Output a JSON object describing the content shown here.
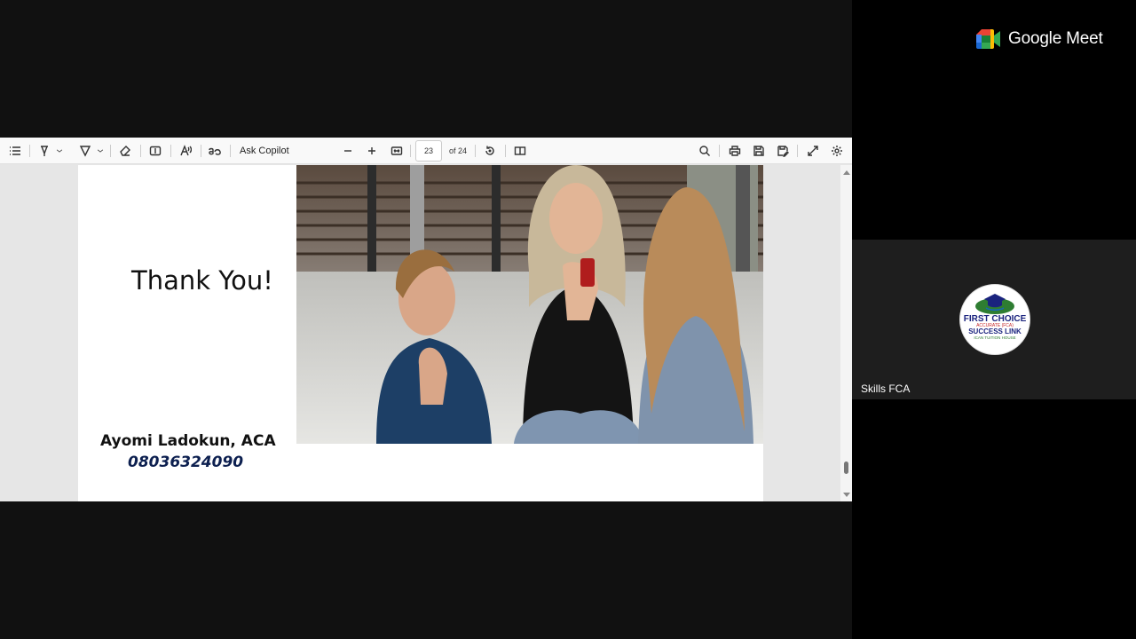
{
  "toolbar": {
    "ask_copilot": "Ask Copilot",
    "page_number": "23",
    "page_total": "of 24"
  },
  "slide": {
    "heading": "Thank You!",
    "author": "Ayomi Ladokun, ACA",
    "phone": "08036324090"
  },
  "meet": {
    "brand": "Google Meet"
  },
  "participant": {
    "name": "Skills FCA",
    "logo_line1": "FIRST CHOICE",
    "logo_line2": "ACCURATE (FCA)",
    "logo_line3": "SUCCESS LINK",
    "logo_line4": "ICAN TUITION HOUSE"
  },
  "icons": [
    "contents-icon",
    "draw-icon",
    "highlight-icon",
    "eraser-icon",
    "text-box-icon",
    "read-aloud-icon",
    "translate-icon",
    "zoom-out-icon",
    "zoom-in-icon",
    "fit-page-icon",
    "rotate-icon",
    "page-view-icon",
    "search-icon",
    "print-icon",
    "save-icon",
    "save-as-icon",
    "fullscreen-icon",
    "settings-icon"
  ]
}
